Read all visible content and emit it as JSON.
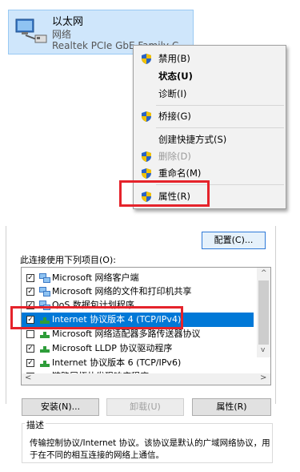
{
  "adapter": {
    "name": "以太网",
    "type": "网络",
    "description": "Realtek PCIe GbE Family C"
  },
  "context_menu": {
    "items": [
      {
        "label": "禁用(B)",
        "icon": "shield-icon"
      },
      {
        "label": "状态(U)",
        "bold": true
      },
      {
        "label": "诊断(I)"
      },
      {
        "label": "桥接(G)",
        "icon": "shield-icon"
      },
      {
        "label": "创建快捷方式(S)"
      },
      {
        "label": "删除(D)",
        "icon": "shield-icon",
        "disabled": true
      },
      {
        "label": "重命名(M)",
        "icon": "shield-icon"
      },
      {
        "label": "属性(R)",
        "icon": "shield-icon"
      }
    ]
  },
  "dialog": {
    "configure_button": "配置(C)...",
    "items_label": "此连接使用下列项目(O):",
    "items": [
      {
        "checked": true,
        "icon": "network-client-icon",
        "label": "Microsoft 网络客户端"
      },
      {
        "checked": true,
        "icon": "network-client-icon",
        "label": "Microsoft 网络的文件和打印机共享"
      },
      {
        "checked": true,
        "icon": "network-client-icon",
        "label": "QoS 数据包计划程序"
      },
      {
        "checked": true,
        "icon": "protocol-icon",
        "label": "Internet 协议版本 4 (TCP/IPv4)",
        "selected": true
      },
      {
        "checked": false,
        "icon": "protocol-icon",
        "label": "Microsoft 网络适配器多路传送器协议"
      },
      {
        "checked": true,
        "icon": "protocol-icon",
        "label": "Microsoft LLDP 协议驱动程序"
      },
      {
        "checked": true,
        "icon": "protocol-icon",
        "label": "Internet 协议版本 6 (TCP/IPv6)"
      },
      {
        "checked": true,
        "icon": "protocol-icon",
        "label": "链路层拓扑发现响应程序"
      }
    ],
    "install_button": "安装(N)...",
    "uninstall_button": "卸载(U)",
    "properties_button": "属性(R)",
    "description_title": "描述",
    "description_lines": [
      "传输控制协议/Internet 协议。该协议是默认的广域网络协议，用",
      "于在不同的相互连接的网络上通信。"
    ]
  },
  "colors": {
    "highlight": "#e5232b",
    "selection": "#0078d7",
    "tile": "#cfe6fb"
  }
}
